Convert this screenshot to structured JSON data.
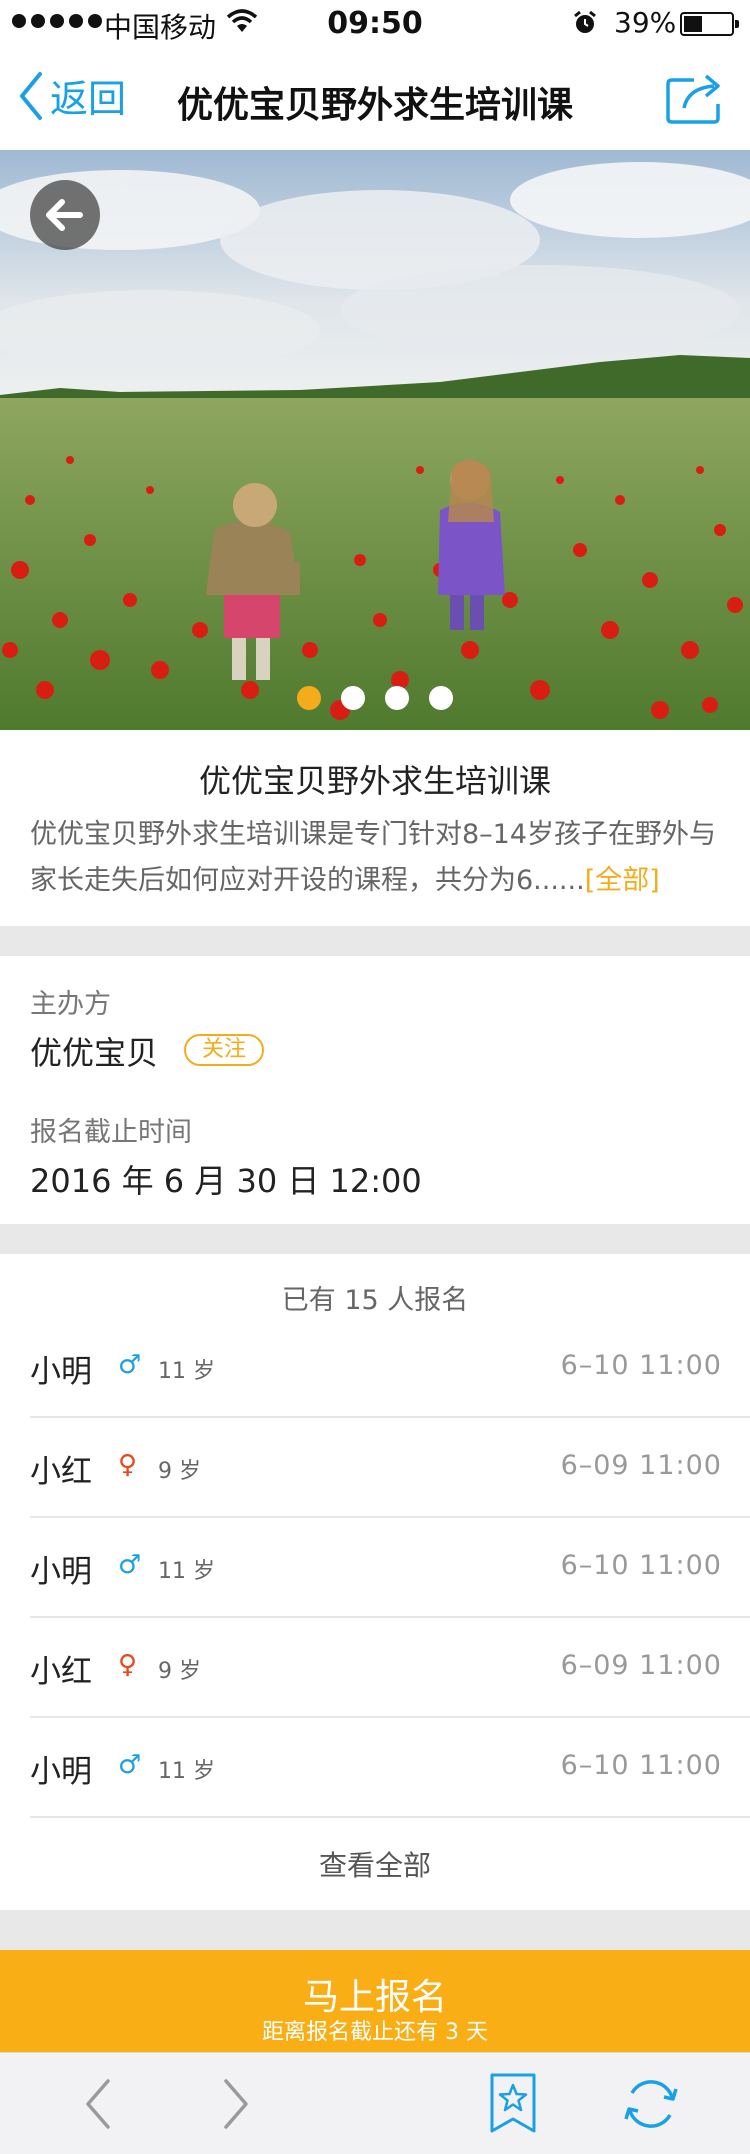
{
  "status_bar": {
    "carrier": "中国移动",
    "time": "09:50",
    "battery_pct": "39%",
    "battery_level": 0.39
  },
  "nav": {
    "back_label": "返回",
    "title": "优优宝贝野外求生培训课"
  },
  "hero": {
    "pager_count": 4,
    "pager_active": 0
  },
  "intro": {
    "name": "优优宝贝野外求生培训课",
    "description": "优优宝贝野外求生培训课是专门针对8–14岁孩子在野外与家长走失后如何应对开设的课程，共分为6......",
    "more_label": "[全部]"
  },
  "organizer": {
    "host_label": "主办方",
    "host_name": "优优宝贝",
    "follow_label": "关注",
    "deadline_label": "报名截止时间",
    "deadline_value": "2016 年 6 月 30 日 12:00"
  },
  "signup": {
    "count_text": "已有 15 人报名",
    "rows": [
      {
        "name": "小明",
        "gender": "male",
        "symbol": "♂",
        "age": "11 岁",
        "time": "6–10  11:00"
      },
      {
        "name": "小红",
        "gender": "female",
        "symbol": "♀",
        "age": "9 岁",
        "time": "6–09  11:00"
      },
      {
        "name": "小明",
        "gender": "male",
        "symbol": "♂",
        "age": "11 岁",
        "time": "6–10  11:00"
      },
      {
        "name": "小红",
        "gender": "female",
        "symbol": "♀",
        "age": "9 岁",
        "time": "6–09  11:00"
      },
      {
        "name": "小明",
        "gender": "male",
        "symbol": "♂",
        "age": "11 岁",
        "time": "6–10  11:00"
      }
    ],
    "view_all_label": "查看全部"
  },
  "cta": {
    "label": "马上报名",
    "sub_label": "距离报名截止还有 3 天"
  },
  "colors": {
    "accent_orange": "#f8ae14",
    "link_blue": "#1aa0e6",
    "male_blue": "#1aa0e6",
    "female_red": "#e8481c",
    "separator": "#e8e8e8"
  },
  "icons": {
    "nav_back": "chevron-left-icon",
    "nav_share": "share-icon",
    "hero_back": "arrow-left-icon",
    "toolbar_back": "chevron-left-icon",
    "toolbar_forward": "chevron-right-icon",
    "toolbar_bookmark": "bookmark-star-icon",
    "toolbar_refresh": "refresh-icon"
  }
}
